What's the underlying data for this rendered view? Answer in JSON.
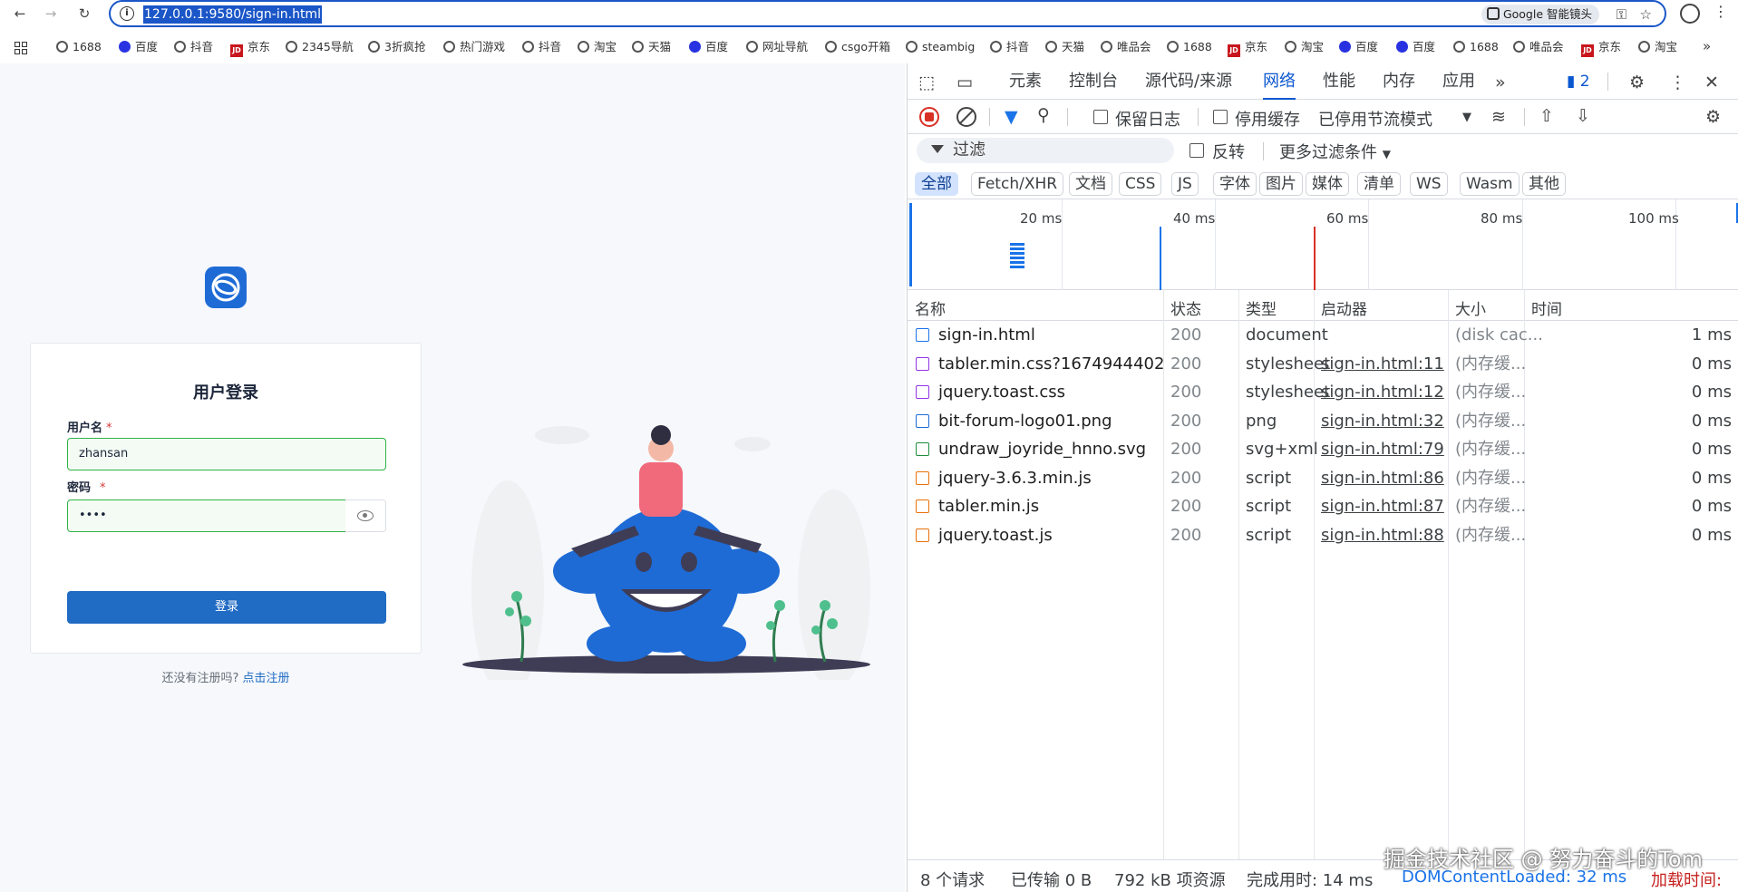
{
  "browser": {
    "url": "127.0.0.1:9580/sign-in.html",
    "lens_chip": "Google 智能镜头"
  },
  "bookmarks": [
    "1688",
    "百度",
    "抖音",
    "京东",
    "2345导航",
    "3折疯抢",
    "热门游戏",
    "抖音",
    "淘宝",
    "天猫",
    "百度",
    "网址导航",
    "csgo开箱",
    "steambig",
    "抖音",
    "天猫",
    "唯品会",
    "1688",
    "京东",
    "淘宝",
    "百度",
    "百度",
    "1688",
    "唯品会",
    "京东",
    "淘宝"
  ],
  "login": {
    "title": "用户登录",
    "username_label": "用户名",
    "username_value": "zhansan",
    "password_label": "密码",
    "password_value": "••••",
    "required_mark": "*",
    "submit": "登录",
    "register_prompt": "还没有注册吗?",
    "register_link": "点击注册"
  },
  "devtools": {
    "tabs": [
      "元素",
      "控制台",
      "源代码/来源",
      "网络",
      "性能",
      "内存",
      "应用"
    ],
    "active_tab": "网络",
    "message_count": "2",
    "toolbar": {
      "preserve_log": "保留日志",
      "disable_cache": "停用缓存",
      "throttle": "已停用节流模式"
    },
    "filter": {
      "placeholder": "过滤",
      "invert": "反转",
      "more": "更多过滤条件"
    },
    "type_filters": [
      "全部",
      "Fetch/XHR",
      "文档",
      "CSS",
      "JS",
      "字体",
      "图片",
      "媒体",
      "清单",
      "WS",
      "Wasm",
      "其他"
    ],
    "timeline_labels": [
      "20 ms",
      "40 ms",
      "60 ms",
      "80 ms",
      "100 ms"
    ],
    "columns": {
      "name": "名称",
      "status": "状态",
      "type": "类型",
      "initiator": "启动器",
      "size": "大小",
      "time": "时间"
    },
    "requests": [
      {
        "name": "sign-in.html",
        "status": "200",
        "type": "document",
        "initiator": "",
        "size": "(disk cac...",
        "time": "1 ms",
        "color": "#1a73e8"
      },
      {
        "name": "tabler.min.css?1674944402",
        "status": "200",
        "type": "stylesheet",
        "initiator": "sign-in.html:11",
        "size": "(内存缓...",
        "time": "0 ms",
        "color": "#9334e6"
      },
      {
        "name": "jquery.toast.css",
        "status": "200",
        "type": "stylesheet",
        "initiator": "sign-in.html:12",
        "size": "(内存缓...",
        "time": "0 ms",
        "color": "#9334e6"
      },
      {
        "name": "bit-forum-logo01.png",
        "status": "200",
        "type": "png",
        "initiator": "sign-in.html:32",
        "size": "(内存缓...",
        "time": "0 ms",
        "color": "#1e6bd6"
      },
      {
        "name": "undraw_joyride_hnno.svg",
        "status": "200",
        "type": "svg+xml",
        "initiator": "sign-in.html:79",
        "size": "(内存缓...",
        "time": "0 ms",
        "color": "#1e8e3e"
      },
      {
        "name": "jquery-3.6.3.min.js",
        "status": "200",
        "type": "script",
        "initiator": "sign-in.html:86",
        "size": "(内存缓...",
        "time": "0 ms",
        "color": "#e8710a"
      },
      {
        "name": "tabler.min.js",
        "status": "200",
        "type": "script",
        "initiator": "sign-in.html:87",
        "size": "(内存缓...",
        "time": "0 ms",
        "color": "#e8710a"
      },
      {
        "name": "jquery.toast.js",
        "status": "200",
        "type": "script",
        "initiator": "sign-in.html:88",
        "size": "(内存缓...",
        "time": "0 ms",
        "color": "#e8710a"
      }
    ],
    "status": {
      "requests": "8 个请求",
      "transferred": "已传输 0 B",
      "resources": "792 kB 项资源",
      "finish": "完成用时: 14 ms",
      "dcl": "DOMContentLoaded: 32 ms",
      "load": "加载时间:"
    }
  },
  "watermark": "掘金技术社区 @ 努力奋斗的Tom"
}
